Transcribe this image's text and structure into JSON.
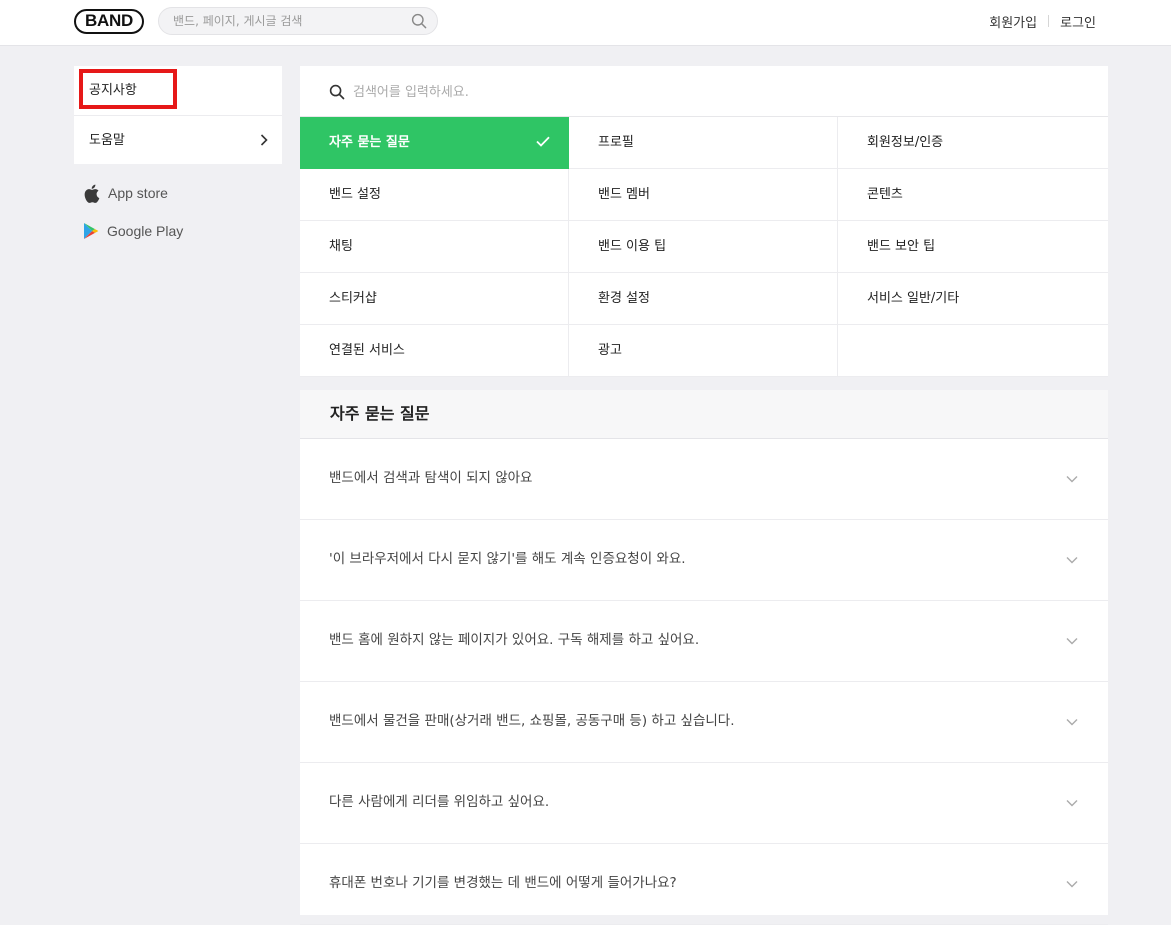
{
  "header": {
    "logo": "BAND",
    "search_placeholder": "밴드, 페이지, 게시글 검색",
    "signup": "회원가입",
    "login": "로그인"
  },
  "sidebar": {
    "items": [
      {
        "label": "공지사항",
        "active": true
      },
      {
        "label": "도움말",
        "active": false
      }
    ],
    "stores": [
      {
        "label": "App store",
        "icon": "apple-icon"
      },
      {
        "label": "Google Play",
        "icon": "google-play-icon"
      }
    ]
  },
  "categories": {
    "search_placeholder": "검색어를 입력하세요.",
    "items": [
      "자주 묻는 질문",
      "프로필",
      "회원정보/인증",
      "밴드 설정",
      "밴드 멤버",
      "콘텐츠",
      "채팅",
      "밴드 이용 팁",
      "밴드 보안 팁",
      "스티커샵",
      "환경 설정",
      "서비스 일반/기타",
      "연결된 서비스",
      "광고",
      ""
    ],
    "selected_index": 0
  },
  "faq": {
    "title": "자주 묻는 질문",
    "items": [
      "밴드에서 검색과 탐색이 되지 않아요",
      "'이 브라우저에서 다시 묻지 않기'를 해도 계속 인증요청이 와요.",
      "밴드 홈에 원하지 않는 페이지가 있어요. 구독 해제를 하고 싶어요.",
      "밴드에서 물건을 판매(상거래 밴드, 쇼핑몰, 공동구매 등) 하고 싶습니다.",
      "다른 사람에게 리더를 위임하고 싶어요.",
      "휴대폰 번호나 기기를 변경했는 데 밴드에 어떻게 들어가나요?"
    ]
  },
  "colors": {
    "accent_green": "#2fc565",
    "highlight_red": "#e61818",
    "background": "#f0f0f3"
  }
}
